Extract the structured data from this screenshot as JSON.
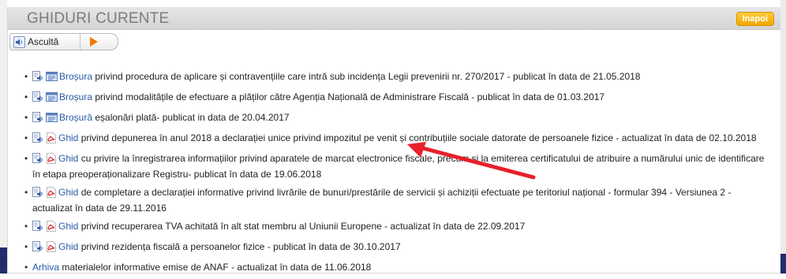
{
  "page": {
    "title": "GHIDURI CURENTE",
    "back_label": "Inapoi"
  },
  "listen": {
    "label": "Ascultă"
  },
  "colors": {
    "link": "#2a5aa8",
    "accent_button": "#f2a500",
    "arrow": "#e8202a"
  },
  "documents": [
    {
      "icons": [
        "speaker-icon",
        "html-icon"
      ],
      "link": "Broșura",
      "text": " privind procedura de aplicare și contravențiile care intră sub incidența Legii prevenirii nr. 270/2017 - publicat în data de 21.05.2018"
    },
    {
      "icons": [
        "speaker-icon",
        "html-icon"
      ],
      "link": "Broșura",
      "text": " privind modalitățile de efectuare a plăților către Agenția Națională de Administrare Fiscală - publicat în data de 01.03.2017"
    },
    {
      "icons": [
        "speaker-icon",
        "html-icon"
      ],
      "link": "Broșură",
      "text": " eșalonări plată- publicat in data de 20.04.2017"
    },
    {
      "icons": [
        "speaker-icon",
        "pdf-icon"
      ],
      "link": "Ghid",
      "text": " privind depunerea în anul 2018 a declarației unice privind impozitul pe venit și contribuțiile sociale datorate de persoanele fizice - actualizat în data de 02.10.2018"
    },
    {
      "icons": [
        "speaker-icon",
        "pdf-icon"
      ],
      "link": "Ghid",
      "text": " cu privire la înregistrarea informațiilor privind aparatele de marcat electronice fiscale, precum și la emiterea certificatului de atribuire a numărului unic de identificare în etapa preoperaționalizare Registru- publicat în data de 19.06.2018"
    },
    {
      "icons": [
        "speaker-icon",
        "pdf-icon"
      ],
      "link": "Ghid",
      "text": " de completare a declarației informative privind livrările de bunuri/prestările de servicii și achiziții efectuate pe teritoriul național - formular 394 - Versiunea 2 - actualizat în data de 29.11.2016"
    },
    {
      "icons": [
        "speaker-icon",
        "pdf-icon"
      ],
      "link": "Ghid",
      "text": " privind recuperarea TVA achitată în alt stat membru al Uniunii Europene - actualizat în data de 22.09.2017"
    },
    {
      "icons": [
        "speaker-icon",
        "pdf-icon"
      ],
      "link": "Ghid",
      "text": " privind rezidența fiscală a persoanelor fizice - publicat în data de 30.10.2017"
    },
    {
      "icons": [],
      "link": "Arhiva",
      "text": " materialelor informative emise de ANAF - actualizat în data de 11.06.2018"
    }
  ]
}
